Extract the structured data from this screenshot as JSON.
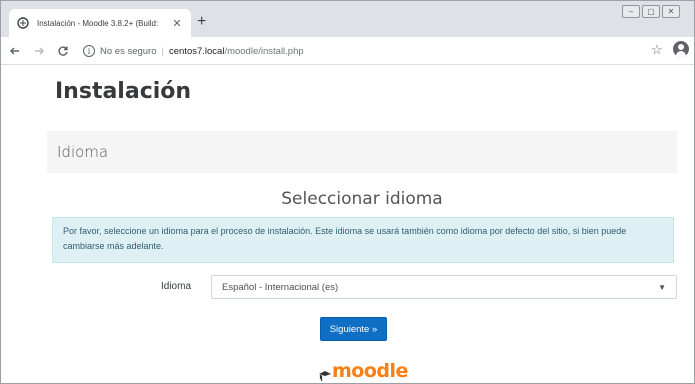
{
  "browser": {
    "tab": {
      "title": "Instalación - Moodle 3.8.2+ (Build:",
      "close_label": "✕"
    },
    "new_tab_label": "+",
    "window_controls": [
      "–",
      "▢",
      "✕"
    ],
    "address_bar": {
      "security_text": "No es seguro",
      "host": "centos7.local",
      "path": "/moodle/install.php"
    },
    "icons": {
      "back": "back-arrow-icon",
      "forward": "forward-arrow-icon",
      "reload": "reload-icon",
      "info": "info-icon",
      "star": "bookmark-star-icon",
      "account": "account-icon",
      "menu": "kebab-menu-icon"
    }
  },
  "page": {
    "heading": "Instalación",
    "step_title": "Idioma",
    "subtitle": "Seleccionar idioma",
    "notice": "Por favor, seleccione un idioma para el proceso de instalación. Este idioma se usará también como idioma por defecto del sitio, si bien puede cambiarse más adelante.",
    "language_label": "Idioma",
    "language_selected": "Español - Internacional (es)",
    "next_button": "Siguiente »",
    "logo_text": "moodle"
  },
  "colors": {
    "accent_button": "#0f6fc5",
    "notice_bg": "#dff0f5",
    "logo_orange": "#f98012"
  }
}
